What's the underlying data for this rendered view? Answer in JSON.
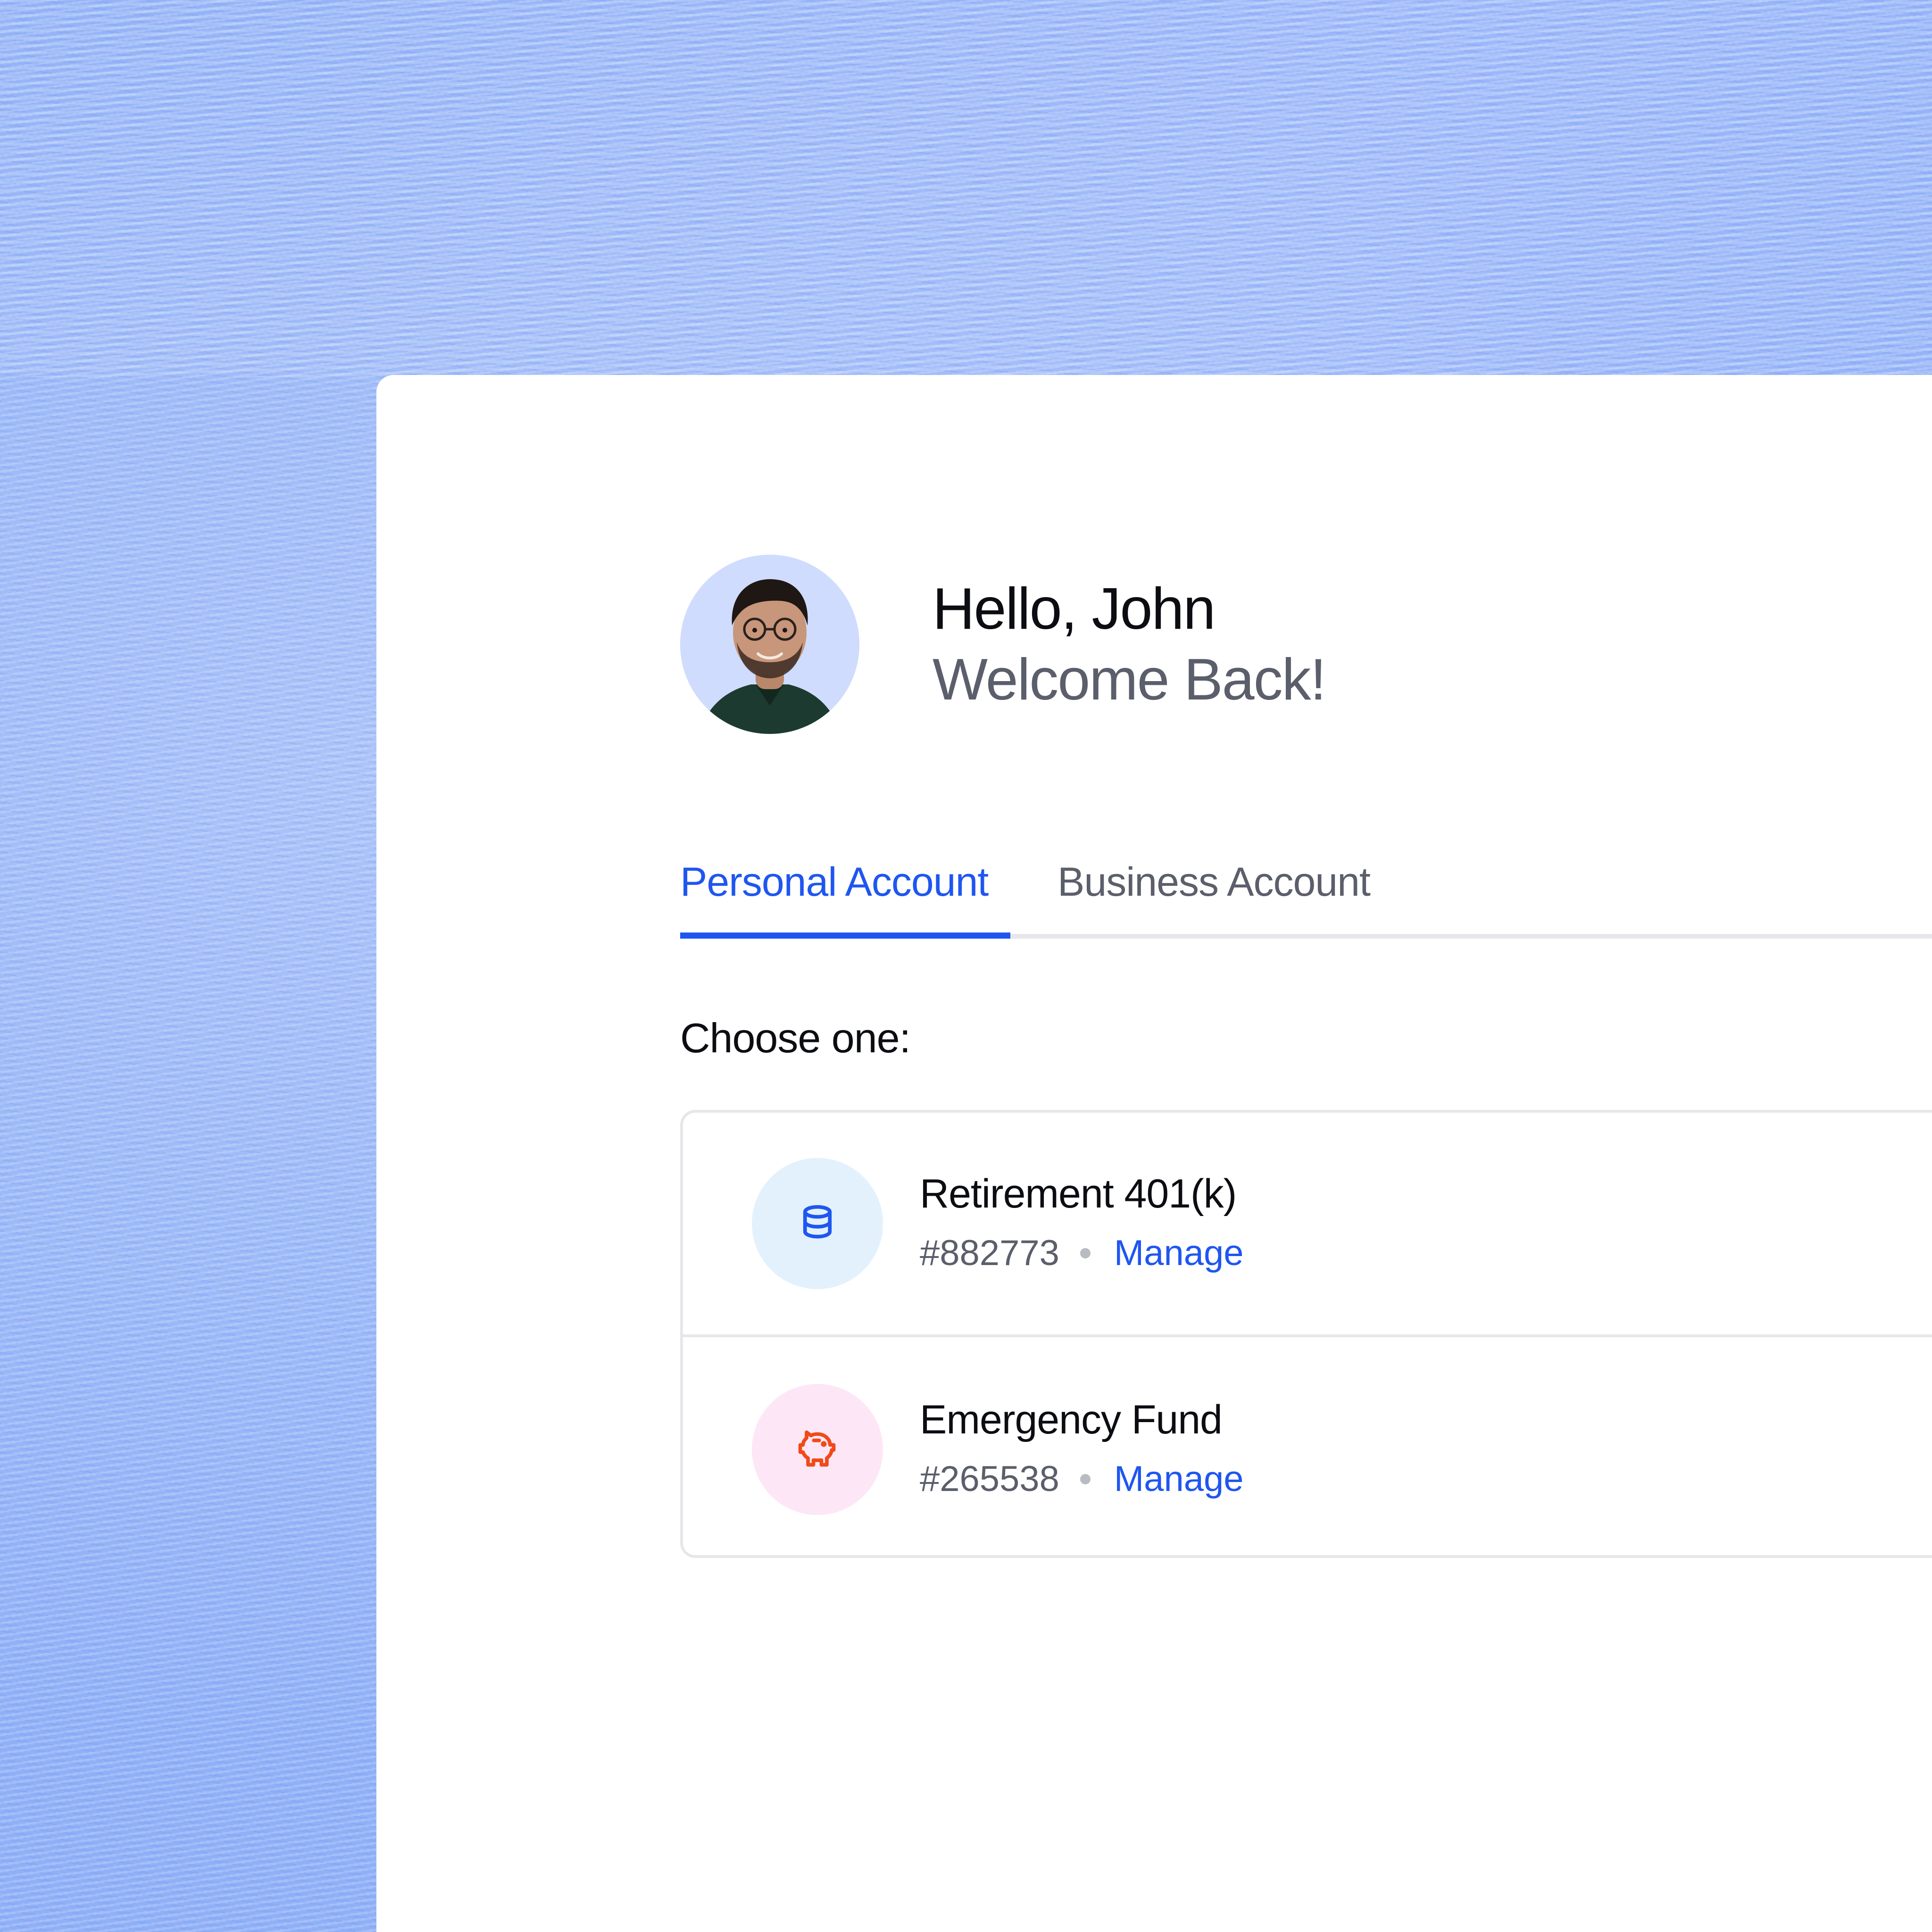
{
  "user": {
    "greeting": "Hello, John",
    "welcome": "Welcome Back!"
  },
  "tabs": [
    {
      "label": "Personal Account",
      "active": true
    },
    {
      "label": "Business Account",
      "active": false
    }
  ],
  "choose_label": "Choose one:",
  "accounts": [
    {
      "name": "Retirement 401(k)",
      "number": "#882773",
      "action": "Manage",
      "icon": "database-coins-icon",
      "icon_color": "#1f56f0",
      "icon_bg": "#e3f1fd"
    },
    {
      "name": "Emergency Fund",
      "number": "#265538",
      "action": "Manage",
      "icon": "piggy-bank-icon",
      "icon_color": "#f04a1a",
      "icon_bg": "#fde7f6"
    }
  ],
  "colors": {
    "accent": "#1f56f0",
    "text_primary": "#0c0d12",
    "text_secondary": "#5b5e6b",
    "background": "#8fb0f7"
  }
}
